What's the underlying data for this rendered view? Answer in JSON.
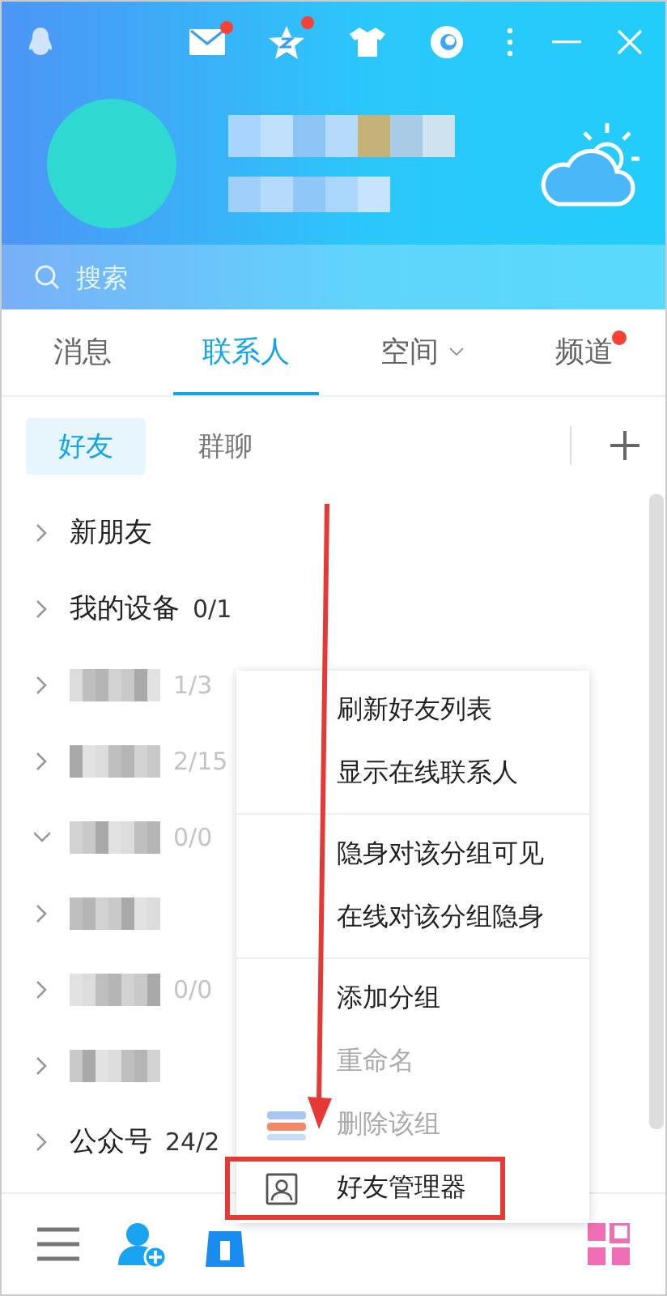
{
  "header_icons": [
    {
      "kind": "mail",
      "badge": true
    },
    {
      "kind": "star",
      "badge": true
    },
    {
      "kind": "shirt",
      "badge": false
    },
    {
      "kind": "swirl",
      "badge": false
    }
  ],
  "search": {
    "placeholder": "搜索"
  },
  "tabs": [
    {
      "label": "消息",
      "selected": false,
      "dropdown": false,
      "badge": false
    },
    {
      "label": "联系人",
      "selected": true,
      "dropdown": false,
      "badge": false
    },
    {
      "label": "空间",
      "selected": false,
      "dropdown": true,
      "badge": false
    },
    {
      "label": "频道",
      "selected": false,
      "dropdown": false,
      "badge": true
    }
  ],
  "subtabs": [
    {
      "label": "好友",
      "selected": true
    },
    {
      "label": "群聊",
      "selected": false
    }
  ],
  "groups": [
    {
      "kind": "plain",
      "name": "新朋友",
      "expanded": false
    },
    {
      "kind": "plain",
      "name": "我的设备",
      "count": "0/1",
      "expanded": false
    },
    {
      "kind": "blurred",
      "count": "1/3",
      "expanded": false
    },
    {
      "kind": "blurred",
      "count": "2/15",
      "expanded": false
    },
    {
      "kind": "blurred",
      "count": "0/0",
      "expanded": true
    },
    {
      "kind": "blurred",
      "expanded": false
    },
    {
      "kind": "blurred",
      "count": "0/0",
      "expanded": false
    },
    {
      "kind": "blurred",
      "expanded": false
    },
    {
      "kind": "plain",
      "name": "公众号",
      "count": "24/2",
      "expanded": false
    }
  ],
  "context_menu": {
    "sections": [
      {
        "items": [
          {
            "label": "刷新好友列表",
            "kind": "plain",
            "disabled": false,
            "highlighted": false
          },
          {
            "label": "显示在线联系人",
            "kind": "plain",
            "disabled": false,
            "highlighted": false
          }
        ]
      },
      {
        "items": [
          {
            "label": "隐身对该分组可见",
            "kind": "plain",
            "disabled": false,
            "highlighted": false
          },
          {
            "label": "在线对该分组隐身",
            "kind": "plain",
            "disabled": false,
            "highlighted": false
          }
        ]
      },
      {
        "items": [
          {
            "label": "添加分组",
            "kind": "plain",
            "disabled": false,
            "highlighted": false
          },
          {
            "label": "重命名",
            "kind": "plain",
            "disabled": true,
            "highlighted": false
          },
          {
            "label": "删除该组",
            "kind": "stack",
            "disabled": true,
            "highlighted": false
          },
          {
            "label": "好友管理器",
            "kind": "card",
            "disabled": false,
            "highlighted": true
          }
        ]
      }
    ]
  },
  "annotation": {
    "arrow": true
  }
}
